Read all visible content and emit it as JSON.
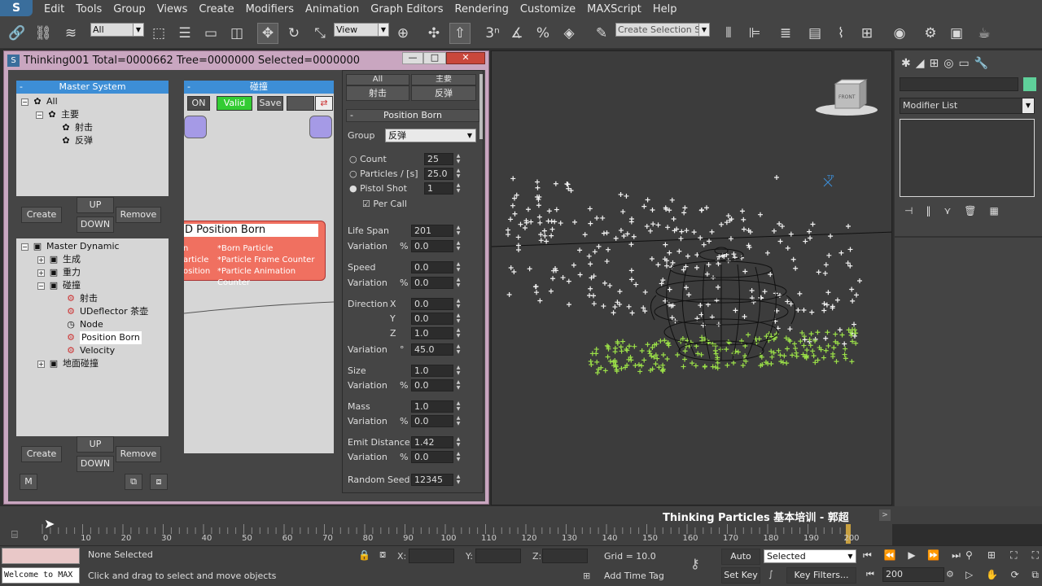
{
  "menu": {
    "logo": "S",
    "items": [
      "Edit",
      "Tools",
      "Group",
      "Views",
      "Create",
      "Modifiers",
      "Animation",
      "Graph Editors",
      "Rendering",
      "Customize",
      "MAXScript",
      "Help"
    ]
  },
  "toolbar": {
    "filter_value": "All",
    "view_value": "View",
    "selection_set_placeholder": "Create Selection Se",
    "snap_label": "3"
  },
  "dialog": {
    "title": "Thinking001  Total=0000662  Tree=0000000  Selected=0000000",
    "master_system": {
      "header": "Master System",
      "items": [
        "All",
        "主要",
        "射击",
        "反弹"
      ]
    },
    "create_label": "Create",
    "up_label": "UP",
    "down_label": "DOWN",
    "remove_label": "Remove",
    "master_dynamic": {
      "items": [
        "Master Dynamic",
        "生成",
        "重力",
        "碰撞",
        "射击",
        "UDeflector 茶壶",
        "Node",
        "Position Born",
        "Velocity",
        "地面碰撞"
      ]
    },
    "m_label": "M",
    "node_editor": {
      "header": "碰撞",
      "on_label": "ON",
      "valid_label": "Valid",
      "save_label": "Save",
      "node_title": "Position Born",
      "ports_left": [
        "n",
        "article",
        "osition"
      ],
      "ports_right": [
        "*Born Particle",
        "*Particle Frame Counter",
        "*Particle Animation Counter"
      ]
    },
    "params": {
      "top_tabs": [
        "All",
        "主要",
        "射击",
        "反弹"
      ],
      "rollout_title": "Position Born",
      "group_label": "Group",
      "group_value": "反弹",
      "count_label": "Count",
      "count_value": "25",
      "particles_label": "Particles  /  [s]",
      "particles_value": "25.0",
      "pistol_label": "Pistol Shot",
      "pistol_value": "1",
      "percall_label": "Per Call",
      "life_label": "Life Span",
      "life_value": "201",
      "life_var_label": "Variation",
      "life_var_unit": "%",
      "life_var_value": "0.0",
      "speed_label": "Speed",
      "speed_value": "0.0",
      "speed_var_label": "Variation",
      "speed_var_unit": "%",
      "speed_var_value": "0.0",
      "dir_label": "Direction",
      "dir_x_label": "X",
      "dir_x": "0.0",
      "dir_y_label": "Y",
      "dir_y": "0.0",
      "dir_z_label": "Z",
      "dir_z": "1.0",
      "dir_var_label": "Variation",
      "dir_var_unit": "°",
      "dir_var_value": "45.0",
      "size_label": "Size",
      "size_value": "1.0",
      "size_var_label": "Variation",
      "size_var_unit": "%",
      "size_var_value": "0.0",
      "mass_label": "Mass",
      "mass_value": "1.0",
      "mass_var_label": "Variation",
      "mass_var_unit": "%",
      "mass_var_value": "0.0",
      "emit_label": "Emit Distance",
      "emit_value": "1.42",
      "emit_var_label": "Variation",
      "emit_var_unit": "%",
      "emit_var_value": "0.0",
      "seed_label": "Random Seed",
      "seed_value": "12345"
    }
  },
  "viewport": {
    "viewcube_label": "FRONT",
    "tp_label": "TP"
  },
  "cmdpanel": {
    "modifier_list": "Modifier List",
    "name_value": ""
  },
  "timeline": {
    "ticks": [
      "0",
      "10",
      "20",
      "30",
      "40",
      "50",
      "60",
      "70",
      "80",
      "90",
      "100",
      "110",
      "120",
      "130",
      "140",
      "150",
      "160",
      "170",
      "180",
      "190",
      "200"
    ],
    "position": 200,
    "max": 200,
    "watermark": "Thinking Particles 基本培训 - 郭超"
  },
  "status": {
    "listener_text": "Welcome to MAX",
    "selection": "None Selected",
    "prompt": "Click and drag to select and move objects",
    "x_label": "X:",
    "y_label": "Y:",
    "z_label": "Z:",
    "x_value": "",
    "y_value": "",
    "z_value": "",
    "grid": "Grid = 10.0",
    "add_time_tag": "Add Time Tag",
    "auto_key": "Auto Key",
    "set_key": "Set Key",
    "key_mode": "Selected",
    "key_filters": "Key Filters...",
    "frame_value": "200"
  },
  "colors": {
    "accent": "#3d8ed6",
    "node": "#f07060",
    "valid": "#33cc33",
    "green_particle": "#9be048",
    "dialog_frame": "#c9a6c0"
  }
}
